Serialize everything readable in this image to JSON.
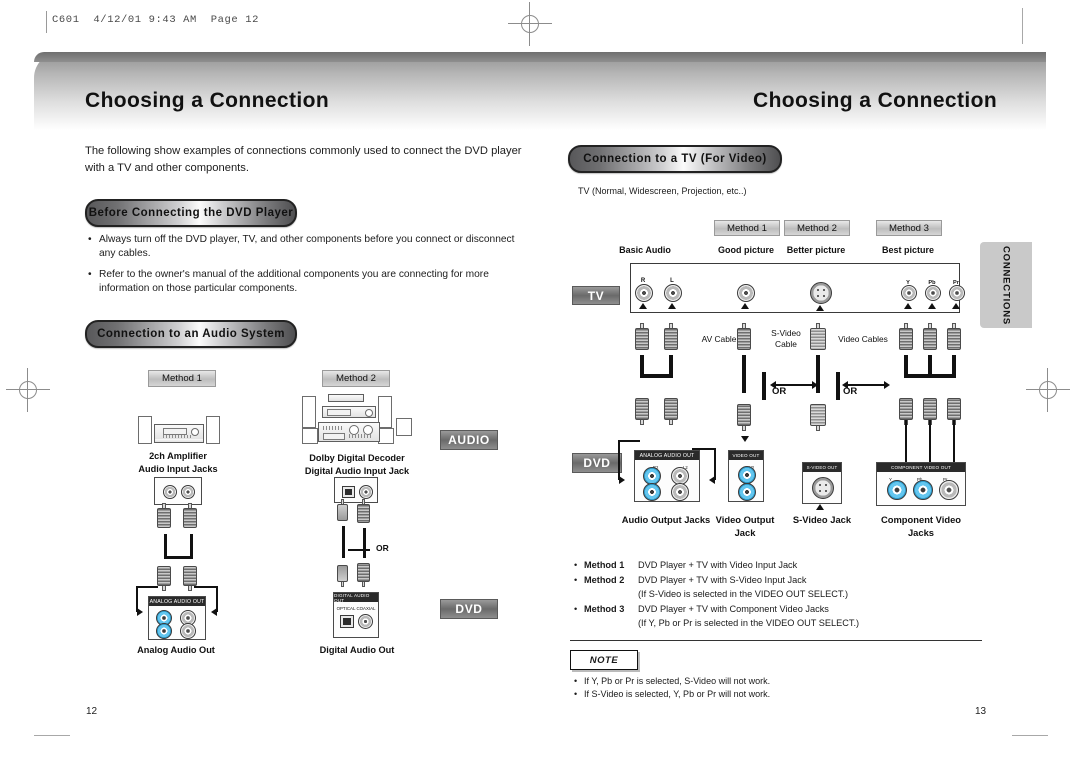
{
  "print_header": "C601  4/12/01 9:43 AM  Page 12",
  "left_page": {
    "chapter_title": "Choosing a Connection",
    "intro": "The following show examples of connections commonly used to connect the DVD player with a TV and other components.",
    "section_before": {
      "heading": "Before Connecting the DVD Player",
      "bullets": [
        "Always turn off the DVD player, TV, and other components before you connect or disconnect any cables.",
        "Refer to the owner's manual of the additional components you are connecting for more information on those particular components."
      ]
    },
    "section_audio": {
      "heading": "Connection to an Audio System",
      "method1_badge": "Method 1",
      "method2_badge": "Method 2",
      "method1_device": "2ch Amplifier\nAudio Input Jacks",
      "method2_device": "Dolby Digital Decoder\nDigital Audio Input Jack",
      "audio_badge": "AUDIO",
      "dvd_badge": "DVD",
      "or_label": "OR",
      "analog_panel_header": "ANALOG AUDIO OUT",
      "digital_panel_header": "DIGITAL AUDIO OUT",
      "digital_opt_label": "OPTICAL",
      "digital_coax_label": "COAXIAL",
      "analog_caption": "Analog Audio Out",
      "digital_caption": "Digital Audio Out",
      "jack_r2": "R2",
      "jack_l2": "L2",
      "jack_r1": "R1",
      "jack_l1": "L1"
    },
    "page_number": "12"
  },
  "right_page": {
    "chapter_title": "Choosing a Connection",
    "section_tv": {
      "heading": "Connection to a TV (For Video)",
      "subtitle": "TV (Normal, Widescreen, Projection, etc..)",
      "method_badges": [
        "Method 1",
        "Method 2",
        "Method 3"
      ],
      "quality_labels": [
        "Basic Audio",
        "Good picture",
        "Better picture",
        "Best picture"
      ],
      "tv_badge": "TV",
      "dvd_badge": "DVD",
      "tv_jacks": [
        "R",
        "L",
        "Y",
        "Pb",
        "Pr"
      ],
      "cable_labels": [
        "AV Cable",
        "S-Video\nCable",
        "Video Cables"
      ],
      "or_labels": [
        "OR",
        "OR"
      ],
      "dvd_panels": [
        {
          "header": "ANALOG AUDIO OUT",
          "caption": "Audio Output Jacks"
        },
        {
          "header": "VIDEO OUT",
          "caption": "Video Output\nJack"
        },
        {
          "header": "S-VIDEO OUT",
          "caption": "S-Video Jack"
        },
        {
          "header": "COMPONENT VIDEO OUT",
          "caption": "Component Video\nJacks"
        }
      ],
      "dvd_jack_labels": {
        "r2": "R2",
        "l2": "L2",
        "r1": "R1",
        "l1": "L1",
        "v2": "V2",
        "v1": "V1",
        "y": "Y",
        "pb": "Pb",
        "pr": "Pr"
      }
    },
    "method_list": [
      {
        "key": "Method 1",
        "text": "DVD Player + TV with Video Input Jack",
        "sub": ""
      },
      {
        "key": "Method 2",
        "text": "DVD Player + TV with S-Video Input Jack",
        "sub": "(If S-Video is selected in the VIDEO OUT SELECT.)"
      },
      {
        "key": "Method 3",
        "text": "DVD Player + TV with Component Video Jacks",
        "sub": "(If Y, Pb or Pr is selected in the VIDEO OUT SELECT.)"
      }
    ],
    "note": {
      "title": "NOTE",
      "bullets": [
        "If Y, Pb or Pr is selected, S-Video will not work.",
        "If S-Video is selected, Y, Pb or Pr will not work."
      ]
    },
    "side_tab": "CONNECTIONS",
    "page_number": "13"
  }
}
